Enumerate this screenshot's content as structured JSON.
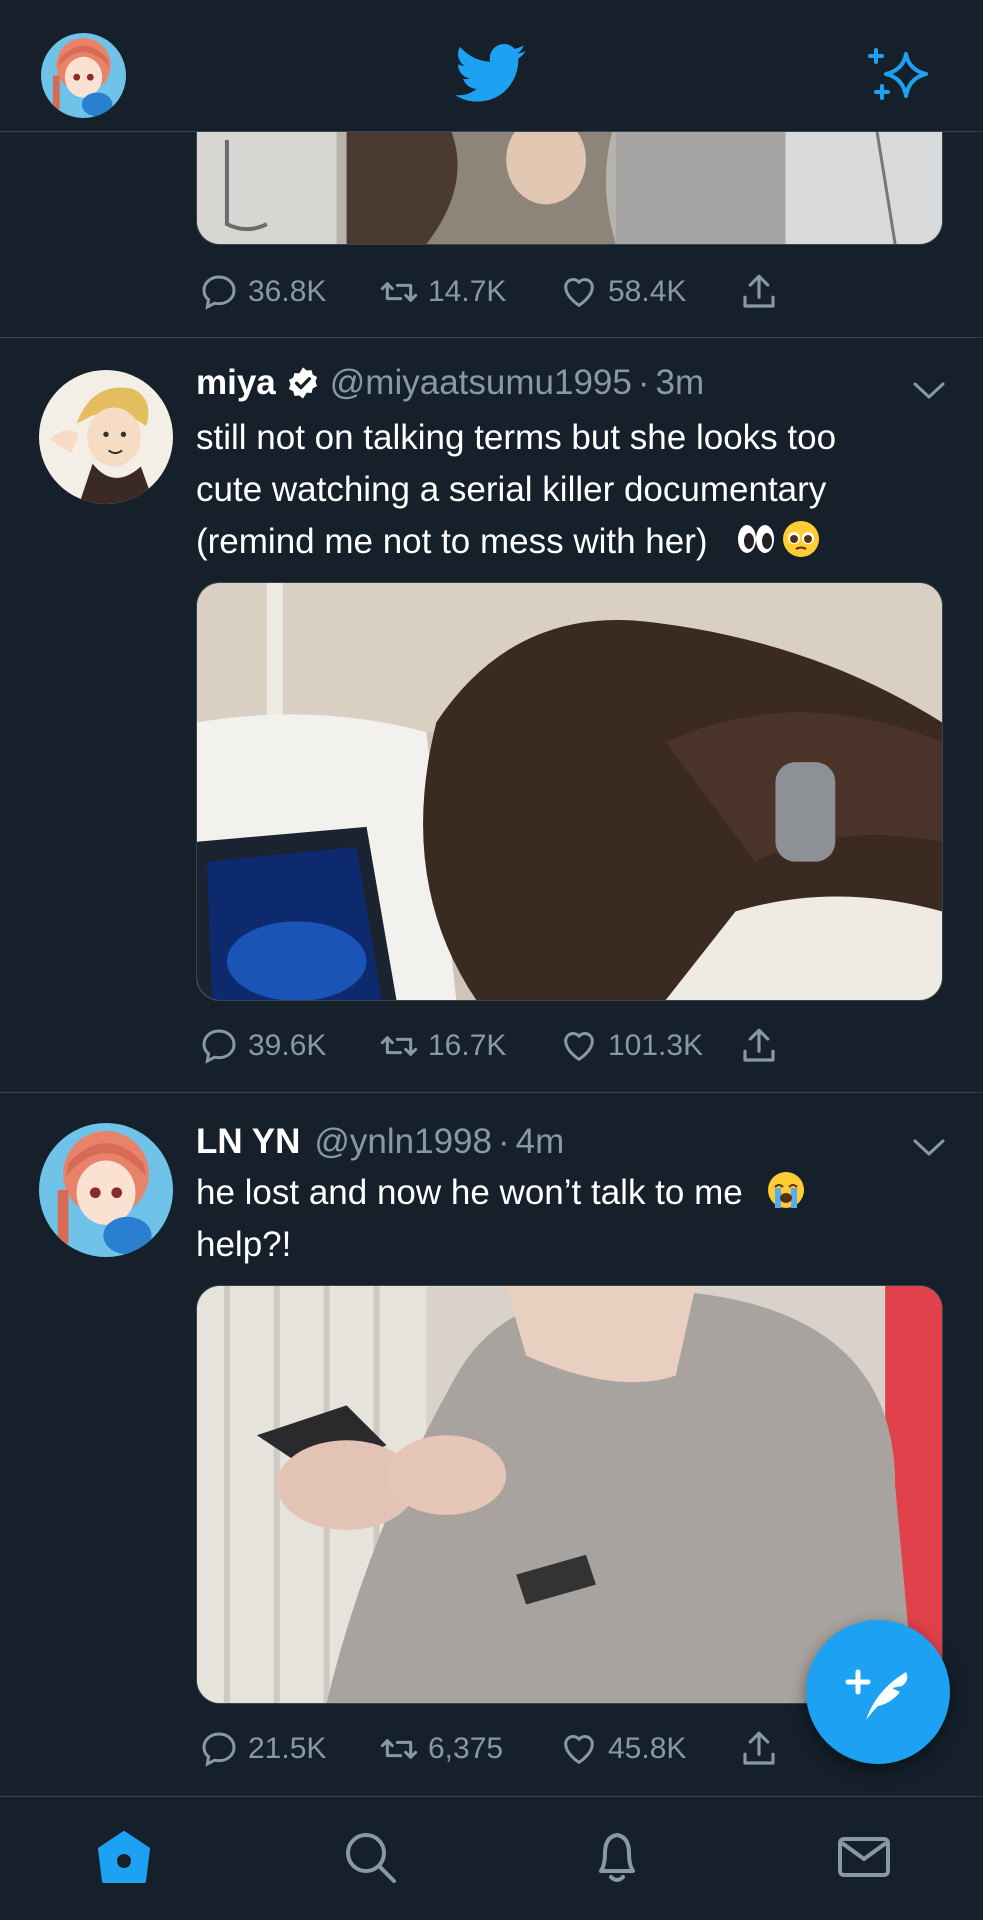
{
  "header": {
    "logo_icon": "twitter-bird-icon",
    "sparkle_icon": "sparkle-icon",
    "avatar_icon": "profile-avatar"
  },
  "colors": {
    "background": "#15202b",
    "accent": "#1da1f2",
    "muted": "#8899a6",
    "divider": "#38444d"
  },
  "tweets": [
    {
      "actions": {
        "replies": "36.8K",
        "retweets": "14.7K",
        "likes": "58.4K"
      }
    },
    {
      "name": "miya",
      "handle": "@miyaatsumu1995",
      "separator": "·",
      "time": "3m",
      "text_lines": [
        "still not on talking terms but she looks too",
        "cute watching a serial killer documentary",
        "(remind me not to mess with her)"
      ],
      "emojis": [
        "eyes-emoji",
        "pleading-face-emoji"
      ],
      "actions": {
        "replies": "39.6K",
        "retweets": "16.7K",
        "likes": "101.3K"
      }
    },
    {
      "name": "LN YN",
      "handle": "@ynln1998",
      "separator": "·",
      "time": "4m",
      "text_lines": [
        "he lost and now he won’t talk to me",
        "help?!"
      ],
      "emojis": [
        "loudly-crying-face-emoji"
      ],
      "actions": {
        "replies": "21.5K",
        "retweets": "6,375",
        "likes": "45.8K"
      }
    }
  ],
  "bottom_nav": [
    "home-icon",
    "search-icon",
    "notifications-icon",
    "messages-icon"
  ],
  "fab": {
    "icon": "compose-tweet-icon"
  }
}
